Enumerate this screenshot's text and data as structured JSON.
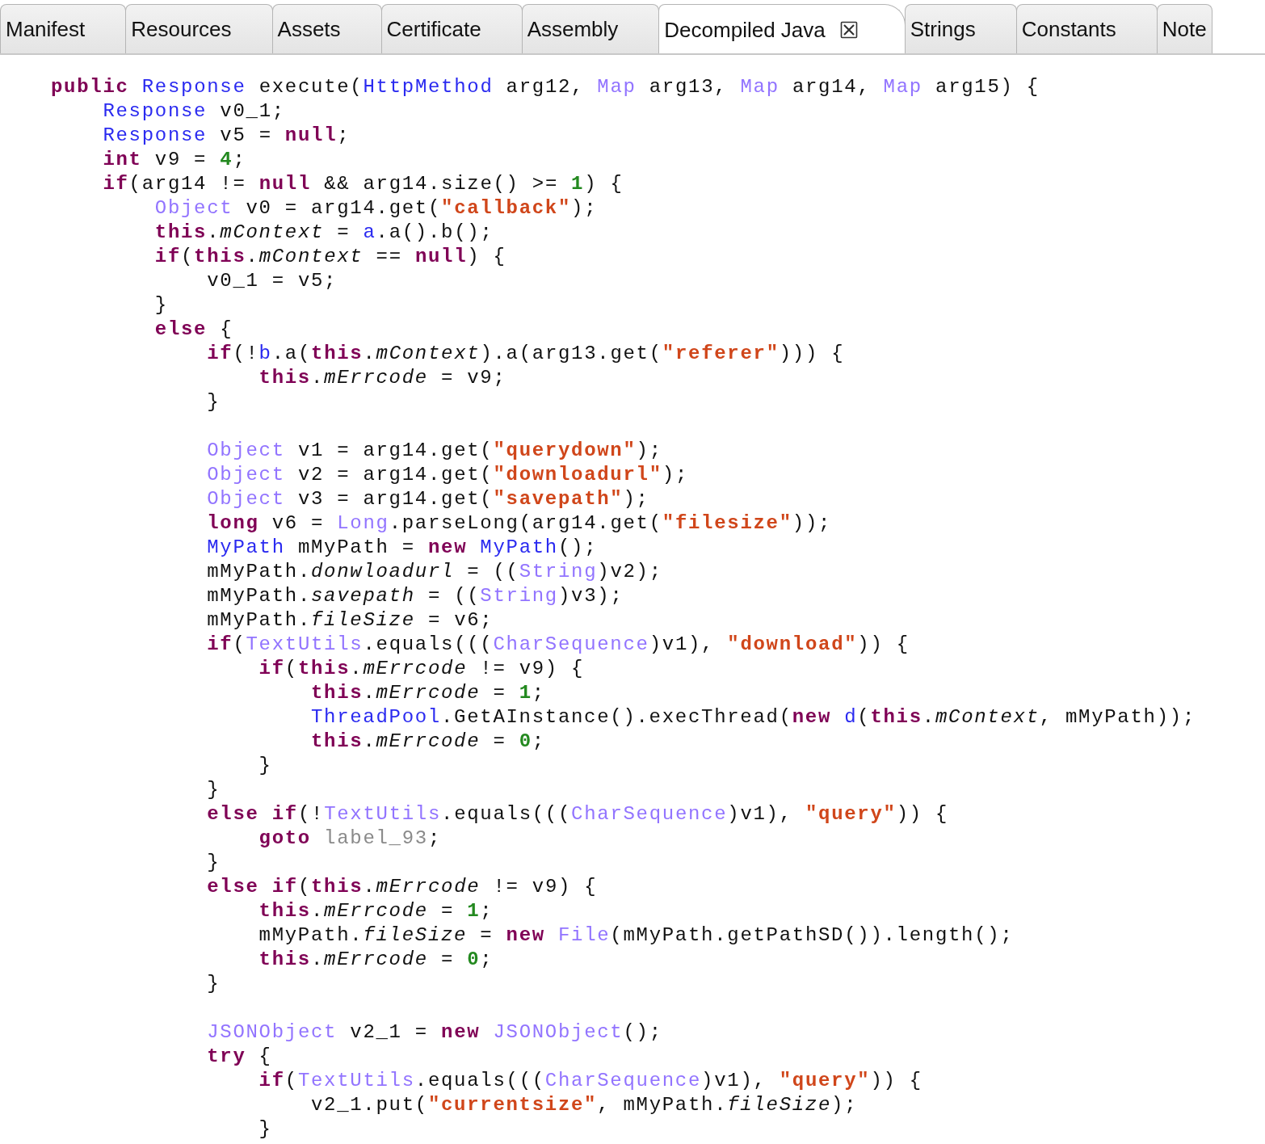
{
  "tabs": [
    {
      "label": "Manifest",
      "selected": false
    },
    {
      "label": "Resources",
      "selected": false
    },
    {
      "label": "Assets",
      "selected": false
    },
    {
      "label": "Certificate",
      "selected": false
    },
    {
      "label": "Assembly",
      "selected": false
    },
    {
      "label": "Decompiled Java",
      "selected": true
    },
    {
      "label": "Strings",
      "selected": false
    },
    {
      "label": "Constants",
      "selected": false
    },
    {
      "label": "Note",
      "selected": false
    }
  ],
  "code_lines": [
    {
      "kind": "code",
      "tokens": [
        {
          "kind": "keyword",
          "text": "public"
        },
        {
          "kind": "type",
          "text": " Response"
        },
        {
          "kind": "plain",
          "text": " execute("
        },
        {
          "kind": "type",
          "text": "HttpMethod"
        },
        {
          "kind": "plain",
          "text": " arg12, "
        },
        {
          "kind": "class",
          "text": "Map"
        },
        {
          "kind": "plain",
          "text": " arg13, "
        },
        {
          "kind": "class",
          "text": "Map"
        },
        {
          "kind": "plain",
          "text": " arg14, "
        },
        {
          "kind": "class",
          "text": "Map"
        },
        {
          "kind": "plain",
          "text": " arg15) {"
        }
      ],
      "children": [
        {
          "kind": "code",
          "tokens": [
            {
              "kind": "type",
              "text": "Response"
            },
            {
              "kind": "plain",
              "text": " v0_1;"
            }
          ]
        },
        {
          "kind": "code",
          "tokens": [
            {
              "kind": "type",
              "text": "Response"
            },
            {
              "kind": "plain",
              "text": " v5 = "
            },
            {
              "kind": "keyword",
              "text": "null"
            },
            {
              "kind": "plain",
              "text": ";"
            }
          ]
        },
        {
          "kind": "code",
          "tokens": [
            {
              "kind": "keyword",
              "text": "int"
            },
            {
              "kind": "plain",
              "text": " v9 = "
            },
            {
              "kind": "number",
              "text": "4"
            },
            {
              "kind": "plain",
              "text": ";"
            }
          ]
        },
        {
          "kind": "code",
          "tokens": [
            {
              "kind": "keyword",
              "text": "if"
            },
            {
              "kind": "plain",
              "text": "(arg14 != "
            },
            {
              "kind": "keyword",
              "text": "null"
            },
            {
              "kind": "plain",
              "text": " && arg14.size() >= "
            },
            {
              "kind": "number",
              "text": "1"
            },
            {
              "kind": "plain",
              "text": ") {"
            }
          ],
          "children": [
            {
              "kind": "code",
              "tokens": [
                {
                  "kind": "class",
                  "text": "Object"
                },
                {
                  "kind": "plain",
                  "text": " v0 = arg14.get("
                },
                {
                  "kind": "string",
                  "text": "\"callback\""
                },
                {
                  "kind": "plain",
                  "text": ");"
                }
              ]
            },
            {
              "kind": "code",
              "tokens": [
                {
                  "kind": "keyword",
                  "text": "this"
                },
                {
                  "kind": "plain",
                  "text": "."
                },
                {
                  "kind": "field",
                  "text": "mContext"
                },
                {
                  "kind": "plain",
                  "text": " = "
                },
                {
                  "kind": "type",
                  "text": "a"
                },
                {
                  "kind": "plain",
                  "text": ".a().b();"
                }
              ]
            },
            {
              "kind": "code",
              "tokens": [
                {
                  "kind": "keyword",
                  "text": "if"
                },
                {
                  "kind": "plain",
                  "text": "("
                },
                {
                  "kind": "keyword",
                  "text": "this"
                },
                {
                  "kind": "plain",
                  "text": "."
                },
                {
                  "kind": "field",
                  "text": "mContext"
                },
                {
                  "kind": "plain",
                  "text": " == "
                },
                {
                  "kind": "keyword",
                  "text": "null"
                },
                {
                  "kind": "plain",
                  "text": ") {"
                }
              ],
              "children": [
                {
                  "kind": "code",
                  "tokens": [
                    {
                      "kind": "plain",
                      "text": "v0_1 = v5;"
                    }
                  ]
                }
              ]
            },
            {
              "kind": "code",
              "tokens": [
                {
                  "kind": "plain",
                  "text": "}"
                }
              ]
            },
            {
              "kind": "code",
              "tokens": [
                {
                  "kind": "keyword",
                  "text": "else"
                },
                {
                  "kind": "plain",
                  "text": " {"
                }
              ],
              "children": [
                {
                  "kind": "code",
                  "tokens": [
                    {
                      "kind": "keyword",
                      "text": "if"
                    },
                    {
                      "kind": "plain",
                      "text": "(!"
                    },
                    {
                      "kind": "type",
                      "text": "b"
                    },
                    {
                      "kind": "plain",
                      "text": ".a("
                    },
                    {
                      "kind": "keyword",
                      "text": "this"
                    },
                    {
                      "kind": "plain",
                      "text": "."
                    },
                    {
                      "kind": "field",
                      "text": "mContext"
                    },
                    {
                      "kind": "plain",
                      "text": ").a(arg13.get("
                    },
                    {
                      "kind": "string",
                      "text": "\"referer\""
                    },
                    {
                      "kind": "plain",
                      "text": "))) {"
                    }
                  ],
                  "children": [
                    {
                      "kind": "code",
                      "tokens": [
                        {
                          "kind": "keyword",
                          "text": "this"
                        },
                        {
                          "kind": "plain",
                          "text": "."
                        },
                        {
                          "kind": "field",
                          "text": "mErrcode"
                        },
                        {
                          "kind": "plain",
                          "text": " = v9;"
                        }
                      ]
                    }
                  ]
                },
                {
                  "kind": "code",
                  "tokens": [
                    {
                      "kind": "plain",
                      "text": "}"
                    }
                  ]
                },
                {
                  "kind": "blank"
                },
                {
                  "kind": "code",
                  "tokens": [
                    {
                      "kind": "class",
                      "text": "Object"
                    },
                    {
                      "kind": "plain",
                      "text": " v1 = arg14.get("
                    },
                    {
                      "kind": "string",
                      "text": "\"querydown\""
                    },
                    {
                      "kind": "plain",
                      "text": ");"
                    }
                  ]
                },
                {
                  "kind": "code",
                  "tokens": [
                    {
                      "kind": "class",
                      "text": "Object"
                    },
                    {
                      "kind": "plain",
                      "text": " v2 = arg14.get("
                    },
                    {
                      "kind": "string",
                      "text": "\"downloadurl\""
                    },
                    {
                      "kind": "plain",
                      "text": ");"
                    }
                  ]
                },
                {
                  "kind": "code",
                  "tokens": [
                    {
                      "kind": "class",
                      "text": "Object"
                    },
                    {
                      "kind": "plain",
                      "text": " v3 = arg14.get("
                    },
                    {
                      "kind": "string",
                      "text": "\"savepath\""
                    },
                    {
                      "kind": "plain",
                      "text": ");"
                    }
                  ]
                },
                {
                  "kind": "code",
                  "tokens": [
                    {
                      "kind": "keyword",
                      "text": "long"
                    },
                    {
                      "kind": "plain",
                      "text": " v6 = "
                    },
                    {
                      "kind": "class",
                      "text": "Long"
                    },
                    {
                      "kind": "plain",
                      "text": ".parseLong(arg14.get("
                    },
                    {
                      "kind": "string",
                      "text": "\"filesize\""
                    },
                    {
                      "kind": "plain",
                      "text": "));"
                    }
                  ]
                },
                {
                  "kind": "code",
                  "tokens": [
                    {
                      "kind": "type",
                      "text": "MyPath"
                    },
                    {
                      "kind": "plain",
                      "text": " mMyPath = "
                    },
                    {
                      "kind": "keyword",
                      "text": "new"
                    },
                    {
                      "kind": "type",
                      "text": " MyPath"
                    },
                    {
                      "kind": "plain",
                      "text": "();"
                    }
                  ]
                },
                {
                  "kind": "code",
                  "tokens": [
                    {
                      "kind": "plain",
                      "text": "mMyPath."
                    },
                    {
                      "kind": "field",
                      "text": "donwloadurl"
                    },
                    {
                      "kind": "plain",
                      "text": " = (("
                    },
                    {
                      "kind": "class",
                      "text": "String"
                    },
                    {
                      "kind": "plain",
                      "text": ")v2);"
                    }
                  ]
                },
                {
                  "kind": "code",
                  "tokens": [
                    {
                      "kind": "plain",
                      "text": "mMyPath."
                    },
                    {
                      "kind": "field",
                      "text": "savepath"
                    },
                    {
                      "kind": "plain",
                      "text": " = (("
                    },
                    {
                      "kind": "class",
                      "text": "String"
                    },
                    {
                      "kind": "plain",
                      "text": ")v3);"
                    }
                  ]
                },
                {
                  "kind": "code",
                  "tokens": [
                    {
                      "kind": "plain",
                      "text": "mMyPath."
                    },
                    {
                      "kind": "field",
                      "text": "fileSize"
                    },
                    {
                      "kind": "plain",
                      "text": " = v6;"
                    }
                  ]
                },
                {
                  "kind": "code",
                  "tokens": [
                    {
                      "kind": "keyword",
                      "text": "if"
                    },
                    {
                      "kind": "plain",
                      "text": "("
                    },
                    {
                      "kind": "class",
                      "text": "TextUtils"
                    },
                    {
                      "kind": "plain",
                      "text": ".equals((("
                    },
                    {
                      "kind": "class",
                      "text": "CharSequence"
                    },
                    {
                      "kind": "plain",
                      "text": ")v1), "
                    },
                    {
                      "kind": "string",
                      "text": "\"download\""
                    },
                    {
                      "kind": "plain",
                      "text": ")) {"
                    }
                  ],
                  "children": [
                    {
                      "kind": "code",
                      "tokens": [
                        {
                          "kind": "keyword",
                          "text": "if"
                        },
                        {
                          "kind": "plain",
                          "text": "("
                        },
                        {
                          "kind": "keyword",
                          "text": "this"
                        },
                        {
                          "kind": "plain",
                          "text": "."
                        },
                        {
                          "kind": "field",
                          "text": "mErrcode"
                        },
                        {
                          "kind": "plain",
                          "text": " != v9) {"
                        }
                      ],
                      "children": [
                        {
                          "kind": "code",
                          "tokens": [
                            {
                              "kind": "keyword",
                              "text": "this"
                            },
                            {
                              "kind": "plain",
                              "text": "."
                            },
                            {
                              "kind": "field",
                              "text": "mErrcode"
                            },
                            {
                              "kind": "plain",
                              "text": " = "
                            },
                            {
                              "kind": "number",
                              "text": "1"
                            },
                            {
                              "kind": "plain",
                              "text": ";"
                            }
                          ]
                        },
                        {
                          "kind": "code",
                          "tokens": [
                            {
                              "kind": "type",
                              "text": "ThreadPool"
                            },
                            {
                              "kind": "plain",
                              "text": ".GetAInstance().execThread("
                            },
                            {
                              "kind": "keyword",
                              "text": "new"
                            },
                            {
                              "kind": "type",
                              "text": " d"
                            },
                            {
                              "kind": "plain",
                              "text": "("
                            },
                            {
                              "kind": "keyword",
                              "text": "this"
                            },
                            {
                              "kind": "plain",
                              "text": "."
                            },
                            {
                              "kind": "field",
                              "text": "mContext"
                            },
                            {
                              "kind": "plain",
                              "text": ", mMyPath));"
                            }
                          ]
                        },
                        {
                          "kind": "code",
                          "tokens": [
                            {
                              "kind": "keyword",
                              "text": "this"
                            },
                            {
                              "kind": "plain",
                              "text": "."
                            },
                            {
                              "kind": "field",
                              "text": "mErrcode"
                            },
                            {
                              "kind": "plain",
                              "text": " = "
                            },
                            {
                              "kind": "number",
                              "text": "0"
                            },
                            {
                              "kind": "plain",
                              "text": ";"
                            }
                          ]
                        }
                      ]
                    },
                    {
                      "kind": "code",
                      "tokens": [
                        {
                          "kind": "plain",
                          "text": "}"
                        }
                      ]
                    }
                  ]
                },
                {
                  "kind": "code",
                  "tokens": [
                    {
                      "kind": "plain",
                      "text": "}"
                    }
                  ]
                },
                {
                  "kind": "code",
                  "tokens": [
                    {
                      "kind": "keyword",
                      "text": "else"
                    },
                    {
                      "kind": "keyword",
                      "text": " if"
                    },
                    {
                      "kind": "plain",
                      "text": "(!"
                    },
                    {
                      "kind": "class",
                      "text": "TextUtils"
                    },
                    {
                      "kind": "plain",
                      "text": ".equals((("
                    },
                    {
                      "kind": "class",
                      "text": "CharSequence"
                    },
                    {
                      "kind": "plain",
                      "text": ")v1), "
                    },
                    {
                      "kind": "string",
                      "text": "\"query\""
                    },
                    {
                      "kind": "plain",
                      "text": ")) {"
                    }
                  ],
                  "children": [
                    {
                      "kind": "code",
                      "tokens": [
                        {
                          "kind": "keyword",
                          "text": "goto"
                        },
                        {
                          "kind": "label",
                          "text": " label_93"
                        },
                        {
                          "kind": "plain",
                          "text": ";"
                        }
                      ]
                    }
                  ]
                },
                {
                  "kind": "code",
                  "tokens": [
                    {
                      "kind": "plain",
                      "text": "}"
                    }
                  ]
                },
                {
                  "kind": "code",
                  "tokens": [
                    {
                      "kind": "keyword",
                      "text": "else"
                    },
                    {
                      "kind": "keyword",
                      "text": " if"
                    },
                    {
                      "kind": "plain",
                      "text": "("
                    },
                    {
                      "kind": "keyword",
                      "text": "this"
                    },
                    {
                      "kind": "plain",
                      "text": "."
                    },
                    {
                      "kind": "field",
                      "text": "mErrcode"
                    },
                    {
                      "kind": "plain",
                      "text": " != v9) {"
                    }
                  ],
                  "children": [
                    {
                      "kind": "code",
                      "tokens": [
                        {
                          "kind": "keyword",
                          "text": "this"
                        },
                        {
                          "kind": "plain",
                          "text": "."
                        },
                        {
                          "kind": "field",
                          "text": "mErrcode"
                        },
                        {
                          "kind": "plain",
                          "text": " = "
                        },
                        {
                          "kind": "number",
                          "text": "1"
                        },
                        {
                          "kind": "plain",
                          "text": ";"
                        }
                      ]
                    },
                    {
                      "kind": "code",
                      "tokens": [
                        {
                          "kind": "plain",
                          "text": "mMyPath."
                        },
                        {
                          "kind": "field",
                          "text": "fileSize"
                        },
                        {
                          "kind": "plain",
                          "text": " = "
                        },
                        {
                          "kind": "keyword",
                          "text": "new"
                        },
                        {
                          "kind": "class",
                          "text": " File"
                        },
                        {
                          "kind": "plain",
                          "text": "(mMyPath.getPathSD()).length();"
                        }
                      ]
                    },
                    {
                      "kind": "code",
                      "tokens": [
                        {
                          "kind": "keyword",
                          "text": "this"
                        },
                        {
                          "kind": "plain",
                          "text": "."
                        },
                        {
                          "kind": "field",
                          "text": "mErrcode"
                        },
                        {
                          "kind": "plain",
                          "text": " = "
                        },
                        {
                          "kind": "number",
                          "text": "0"
                        },
                        {
                          "kind": "plain",
                          "text": ";"
                        }
                      ]
                    }
                  ]
                },
                {
                  "kind": "code",
                  "tokens": [
                    {
                      "kind": "plain",
                      "text": "}"
                    }
                  ]
                },
                {
                  "kind": "blank"
                },
                {
                  "kind": "code",
                  "tokens": [
                    {
                      "kind": "class",
                      "text": "JSONObject"
                    },
                    {
                      "kind": "plain",
                      "text": " v2_1 = "
                    },
                    {
                      "kind": "keyword",
                      "text": "new"
                    },
                    {
                      "kind": "class",
                      "text": " JSONObject"
                    },
                    {
                      "kind": "plain",
                      "text": "();"
                    }
                  ]
                },
                {
                  "kind": "code",
                  "tokens": [
                    {
                      "kind": "keyword",
                      "text": "try"
                    },
                    {
                      "kind": "plain",
                      "text": " {"
                    }
                  ],
                  "children": [
                    {
                      "kind": "code",
                      "tokens": [
                        {
                          "kind": "keyword",
                          "text": "if"
                        },
                        {
                          "kind": "plain",
                          "text": "("
                        },
                        {
                          "kind": "class",
                          "text": "TextUtils"
                        },
                        {
                          "kind": "plain",
                          "text": ".equals((("
                        },
                        {
                          "kind": "class",
                          "text": "CharSequence"
                        },
                        {
                          "kind": "plain",
                          "text": ")v1), "
                        },
                        {
                          "kind": "string",
                          "text": "\"query\""
                        },
                        {
                          "kind": "plain",
                          "text": ")) {"
                        }
                      ],
                      "children": [
                        {
                          "kind": "code",
                          "tokens": [
                            {
                              "kind": "plain",
                              "text": "v2_1.put("
                            },
                            {
                              "kind": "string",
                              "text": "\"currentsize\""
                            },
                            {
                              "kind": "plain",
                              "text": ", mMyPath."
                            },
                            {
                              "kind": "field",
                              "text": "fileSize"
                            },
                            {
                              "kind": "plain",
                              "text": ");"
                            }
                          ]
                        }
                      ]
                    },
                    {
                      "kind": "code",
                      "tokens": [
                        {
                          "kind": "plain",
                          "text": "}"
                        }
                      ]
                    }
                  ]
                }
              ]
            }
          ]
        }
      ]
    }
  ]
}
